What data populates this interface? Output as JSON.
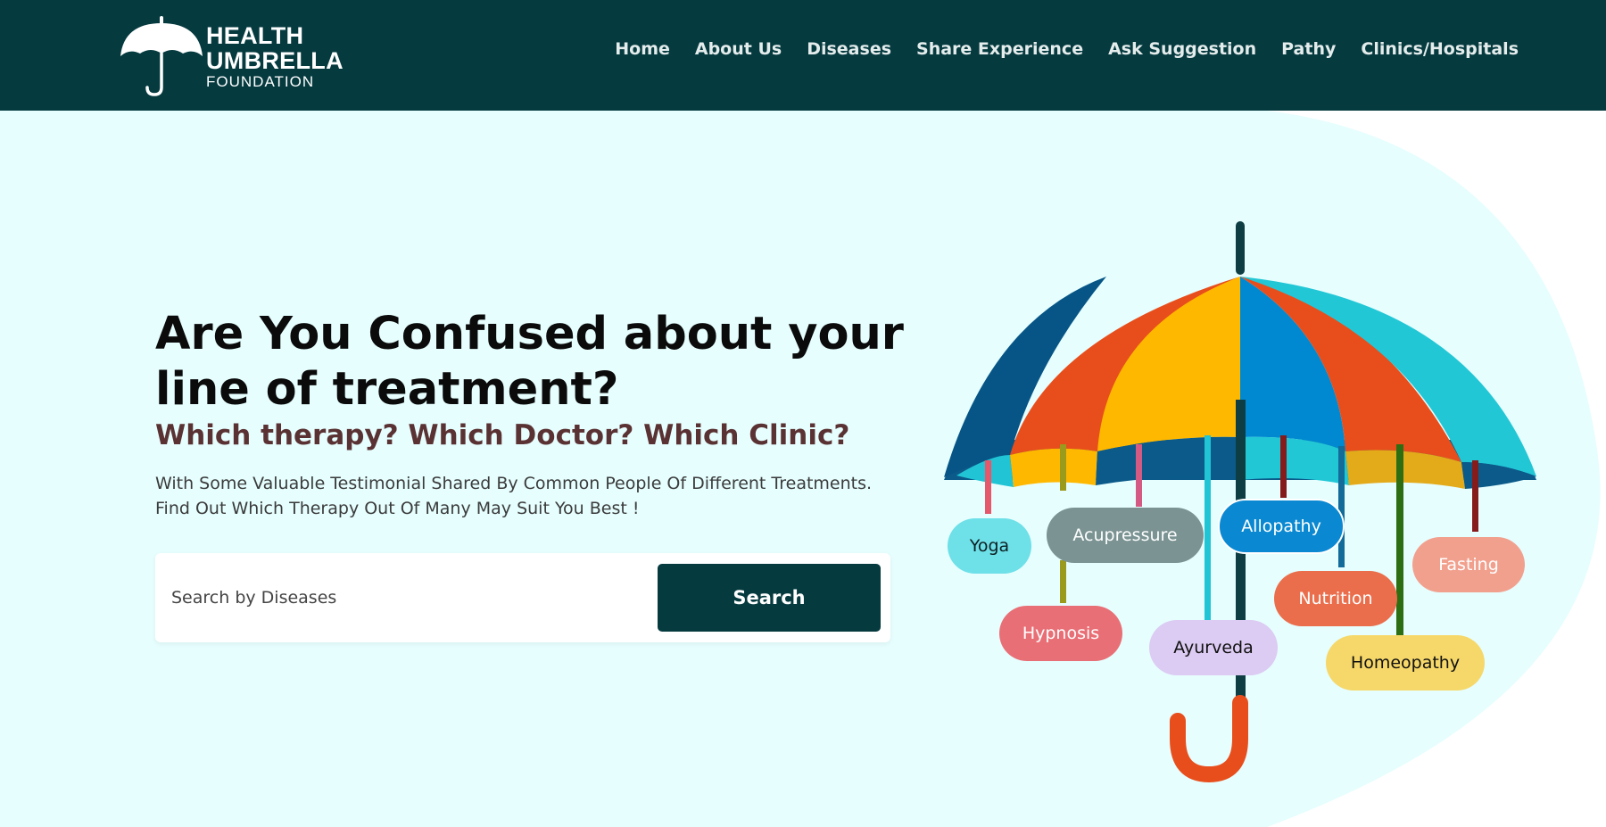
{
  "brand": {
    "line1": "HEALTH",
    "line2": "UMBRELLA",
    "line3": "FOUNDATION",
    "primary_color": "#053a3f",
    "hero_bg": "#e6fefe"
  },
  "nav": {
    "items": [
      {
        "label": "Home"
      },
      {
        "label": "About Us"
      },
      {
        "label": "Diseases"
      },
      {
        "label": "Share Experience"
      },
      {
        "label": "Ask Suggestion"
      },
      {
        "label": "Pathy"
      },
      {
        "label": "Clinics/Hospitals"
      }
    ]
  },
  "hero": {
    "headline": "Are You Confused about your line of treatment?",
    "subheadline": "Which therapy? Which Doctor? Which Clinic?",
    "description_line1": "With Some Valuable Testimonial Shared By Common People Of Different Treatments.",
    "description_line2": "Find Out Which Therapy Out Of Many May Suit You Best !"
  },
  "search": {
    "placeholder": "Search by Diseases",
    "value": "",
    "button_label": "Search"
  },
  "therapies": [
    {
      "label": "Yoga",
      "bg": "#6ee0e8",
      "color": "#0b1f22"
    },
    {
      "label": "Acupressure",
      "bg": "#7b9393",
      "color": "#ffffff"
    },
    {
      "label": "Allopathy",
      "bg": "#0a89d2",
      "color": "#ffffff"
    },
    {
      "label": "Fasting",
      "bg": "#f2a08e",
      "color": "#ffffff"
    },
    {
      "label": "Nutrition",
      "bg": "#ea6e4c",
      "color": "#ffffff"
    },
    {
      "label": "Hypnosis",
      "bg": "#e96f76",
      "color": "#ffffff"
    },
    {
      "label": "Ayurveda",
      "bg": "#dccbf2",
      "color": "#111111"
    },
    {
      "label": "Homeopathy",
      "bg": "#f6d86a",
      "color": "#111111"
    }
  ]
}
